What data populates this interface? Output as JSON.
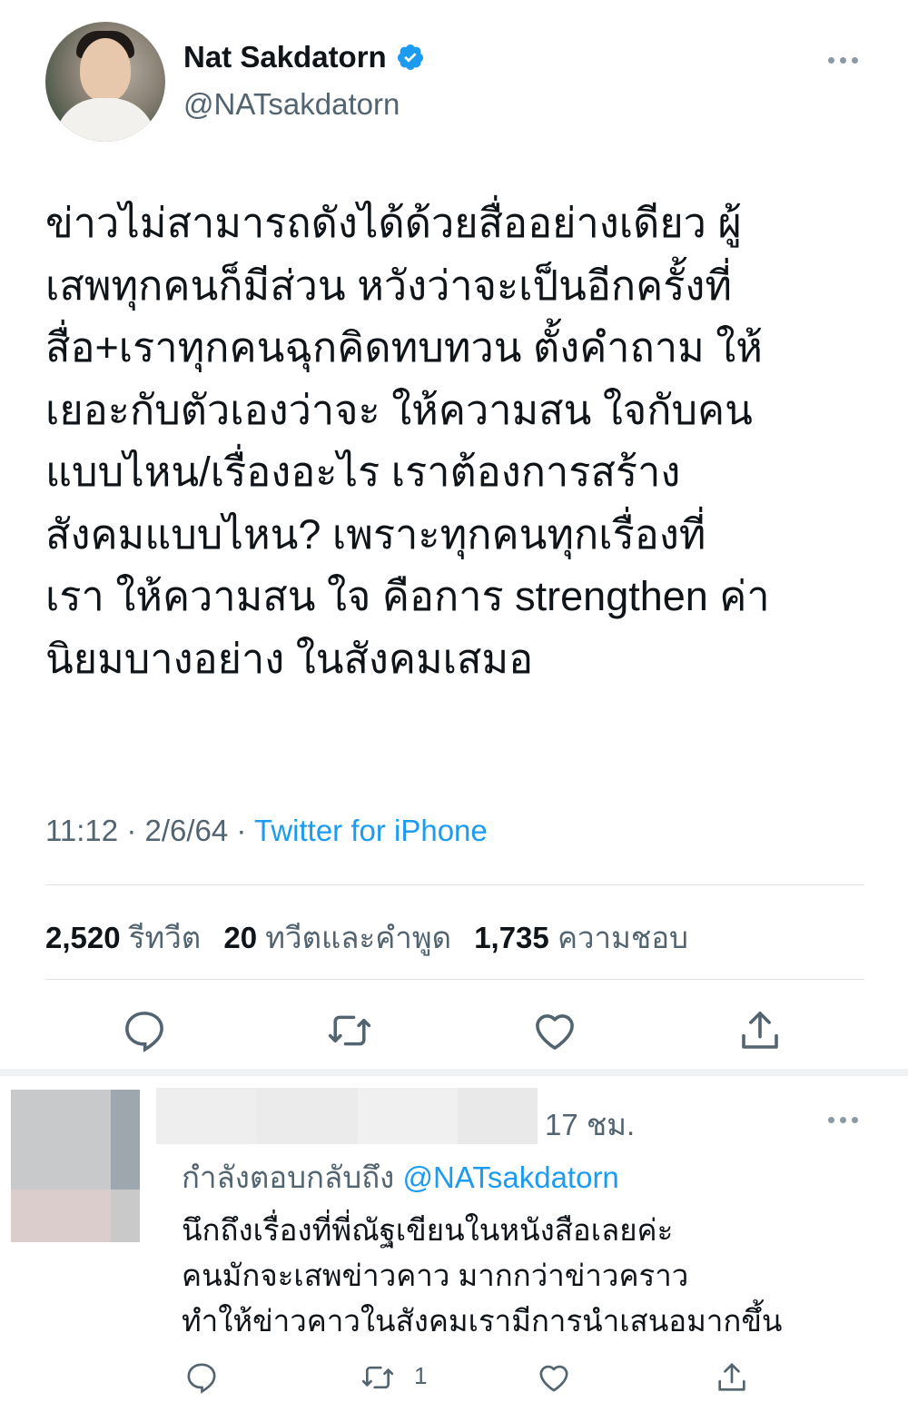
{
  "tweet": {
    "author_name": "Nat Sakdatorn",
    "author_handle": "@NATsakdatorn",
    "verified": true,
    "text": "ข่าวไม่สามารถดังได้ด้วยสื่ออย่างเดียว ผู้\nเสพทุกคนก็มีส่วน หวังว่าจะเป็นอีกครั้งที่\nสื่อ+เราทุกคนฉุกคิดทบทวน ตั้งคำถาม ให้\nเยอะกับตัวเองว่าจะ ให้ความสน ใจกับคน\nแบบไหน/เรื่องอะไร เราต้องการสร้าง\nสังคมแบบไหน? เพราะทุกคนทุกเรื่องที่\nเรา ให้ความสน ใจ คือการ strengthen ค่า\nนิยมบางอย่าง ในสังคมเสมอ",
    "time": "11:12",
    "date": "2/6/64",
    "dot": "·",
    "source": "Twitter for iPhone",
    "stats": {
      "retweets_count": "2,520",
      "retweets_label": "รีทวีต",
      "quotes_count": "20",
      "quotes_label": "ทวีตและคำพูด",
      "likes_count": "1,735",
      "likes_label": "ความชอบ"
    },
    "actions": [
      "reply-icon",
      "retweet-icon",
      "like-icon",
      "share-icon"
    ]
  },
  "reply": {
    "time": "17 ชม.",
    "replying_to_label": "กำลังตอบกลับถึง",
    "replying_to_handle": "@NATsakdatorn",
    "text": "นึกถึงเรื่องที่พี่ณัฐเขียนในหนังสือเลยค่ะ\nคนมักจะเสพข่าวคาว มากกว่าข่าวคราว\nทำให้ข่าวคาวในสังคมเรามีการนำเสนอมากขึ้น",
    "retweet_count": "1"
  },
  "colors": {
    "accent": "#1d9bf0",
    "secondary_text": "#536471",
    "primary_text": "#0f1419",
    "divider": "#e1e4e6"
  }
}
